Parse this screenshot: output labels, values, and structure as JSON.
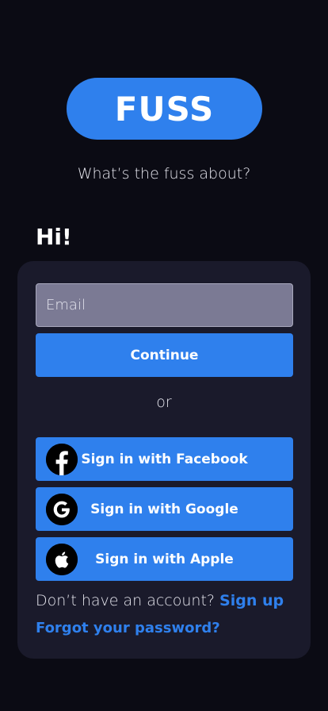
{
  "brand": {
    "logo_text": "FUSS",
    "tagline": "What’s the fuss about?"
  },
  "greeting": "Hi!",
  "form": {
    "email_placeholder": "Email",
    "email_value": "",
    "continue_label": "Continue",
    "separator": "or"
  },
  "social": {
    "facebook_label": "Sign in with Facebook",
    "google_label": "Sign in with Google",
    "apple_label": "Sign in with Apple",
    "facebook_icon": "facebook-icon",
    "google_icon": "google-icon",
    "apple_icon": "apple-icon"
  },
  "footer": {
    "no_account_text": "Don’t have an account?",
    "signup_label": "Sign up",
    "forgot_label": "Forgot your password?"
  },
  "colors": {
    "background": "#0b0b14",
    "card": "#1a1a2b",
    "accent": "#2f80ed",
    "input_fill": "#7b7a94"
  }
}
